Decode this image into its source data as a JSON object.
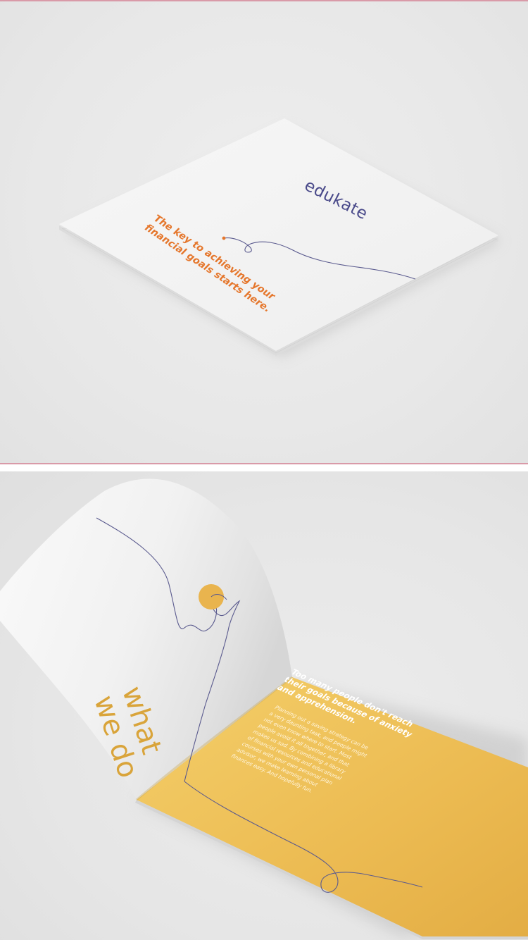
{
  "cover": {
    "logo": "edukate",
    "tagline_lines": [
      "The key to achieving your",
      "financial goals starts here."
    ]
  },
  "spread": {
    "left_title_lines": [
      "what",
      "we do"
    ],
    "right_heading_lines": [
      "Too many people don't reach",
      "their goals because of anxiety",
      "and apprehension."
    ],
    "right_body_lines": [
      "Planning out a saving strategy can be",
      "a very daunting task, and people might",
      "not even know where to start. Most",
      "people avoid it all together, and that",
      "makes us sad. By combining a library",
      "of financial resources and educational",
      "courses with your own personal plan",
      "advisor, we make learning about",
      "finances easy. And hopefully fun."
    ]
  },
  "colors": {
    "background": "#e9e9e9",
    "paper": "#f4f4f4",
    "accent_orange": "#e5762b",
    "accent_yellow": "#e9b44e",
    "line_purple": "#5a5a8e",
    "divider": "#d99aa8"
  }
}
